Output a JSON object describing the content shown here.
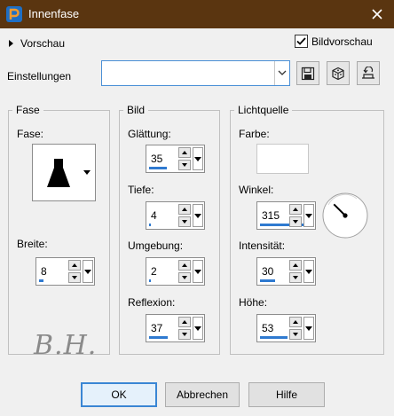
{
  "window": {
    "title": "Innenfase"
  },
  "preview": {
    "label": "Vorschau"
  },
  "bildvorschau": {
    "label": "Bildvorschau",
    "checked": true
  },
  "settings": {
    "label": "Einstellungen",
    "value": ""
  },
  "toolbar_icons": [
    "save-icon",
    "randomize-dice-icon",
    "reset-icon"
  ],
  "groups": {
    "fase": {
      "title": "Fase",
      "shape_label": "Fase:",
      "breite": {
        "label": "Breite:",
        "value": "8",
        "level": 8
      }
    },
    "bild": {
      "title": "Bild",
      "glaettung": {
        "label": "Glättung:",
        "value": "35",
        "level": 35
      },
      "tiefe": {
        "label": "Tiefe:",
        "value": "4",
        "level": 4
      },
      "umgebung": {
        "label": "Umgebung:",
        "value": "2",
        "level": 2
      },
      "reflexion": {
        "label": "Reflexion:",
        "value": "37",
        "level": 37
      }
    },
    "licht": {
      "title": "Lichtquelle",
      "farbe": {
        "label": "Farbe:",
        "color": "#ffffff"
      },
      "winkel": {
        "label": "Winkel:",
        "value": "315",
        "level": 87.5
      },
      "intensitaet": {
        "label": "Intensität:",
        "value": "30",
        "level": 30
      },
      "hoehe": {
        "label": "Höhe:",
        "value": "53",
        "level": 53
      }
    }
  },
  "watermark": "B.H.",
  "buttons": {
    "ok": "OK",
    "abbrechen": "Abbrechen",
    "hilfe": "Hilfe"
  },
  "colors": {
    "titlebar": "#5a3510",
    "accent": "#2f7ad0",
    "focus": "#3a86d4"
  }
}
